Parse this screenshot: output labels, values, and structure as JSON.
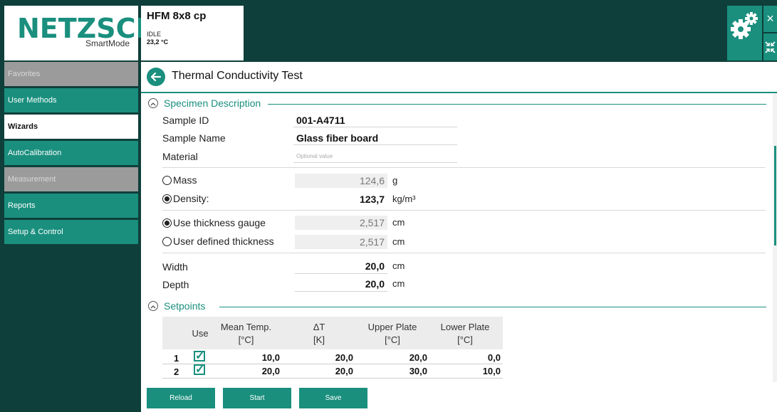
{
  "header": {
    "logo_text": "NETZSCH",
    "logo_subtitle": "SmartMode",
    "instrument_name": "HFM 8x8 cp",
    "instrument_status": "IDLE",
    "instrument_temperature": "23,2 °C",
    "close_glyph": "×"
  },
  "sidebar": {
    "items": [
      {
        "label": "Favorites",
        "state": "disabled"
      },
      {
        "label": "User Methods",
        "state": "normal"
      },
      {
        "label": "Wizards",
        "state": "active"
      },
      {
        "label": "AutoCalibration",
        "state": "normal"
      },
      {
        "label": "Measurement",
        "state": "disabled"
      },
      {
        "label": "Reports",
        "state": "normal"
      },
      {
        "label": "Setup & Control",
        "state": "normal"
      }
    ]
  },
  "main": {
    "title": "Thermal Conductivity Test",
    "specimen": {
      "section_label": "Specimen Description",
      "sample_id_label": "Sample ID",
      "sample_id_value": "001-A4711",
      "sample_name_label": "Sample Name",
      "sample_name_value": "Glass fiber board",
      "material_label": "Material",
      "material_placeholder": "Optional value",
      "mass_label": "Mass",
      "mass_value": "124,6",
      "mass_unit": "g",
      "density_label": "Density:",
      "density_value": "123,7",
      "density_unit": "kg/m³",
      "thickness_gauge_label": "Use thickness gauge",
      "thickness_gauge_value": "2,517",
      "thickness_gauge_unit": "cm",
      "user_thickness_label": "User defined thickness",
      "user_thickness_value": "2,517",
      "user_thickness_unit": "cm",
      "width_label": "Width",
      "width_value": "20,0",
      "width_unit": "cm",
      "depth_label": "Depth",
      "depth_value": "20,0",
      "depth_unit": "cm",
      "selected_mass_mode": "Density",
      "selected_thickness_mode": "Use thickness gauge"
    },
    "setpoints": {
      "section_label": "Setpoints",
      "col_use": "Use",
      "col_mean_temp": "Mean Temp.",
      "col_mean_temp_unit": "[°C]",
      "col_delta_t": "ΔT",
      "col_delta_t_unit": "[K]",
      "col_upper": "Upper Plate",
      "col_upper_unit": "[°C]",
      "col_lower": "Lower Plate",
      "col_lower_unit": "[°C]",
      "rows": [
        {
          "index": "1",
          "use": true,
          "mean": "10,0",
          "delta": "20,0",
          "upper": "20,0",
          "lower": "0,0"
        },
        {
          "index": "2",
          "use": true,
          "mean": "20,0",
          "delta": "20,0",
          "upper": "30,0",
          "lower": "10,0"
        }
      ]
    }
  },
  "buttons": {
    "reload": "Reload",
    "start": "Start",
    "save": "Save"
  },
  "colors": {
    "accent": "#1a8f7e",
    "background": "#0f3f3a",
    "disabled": "#9b9b9b"
  }
}
